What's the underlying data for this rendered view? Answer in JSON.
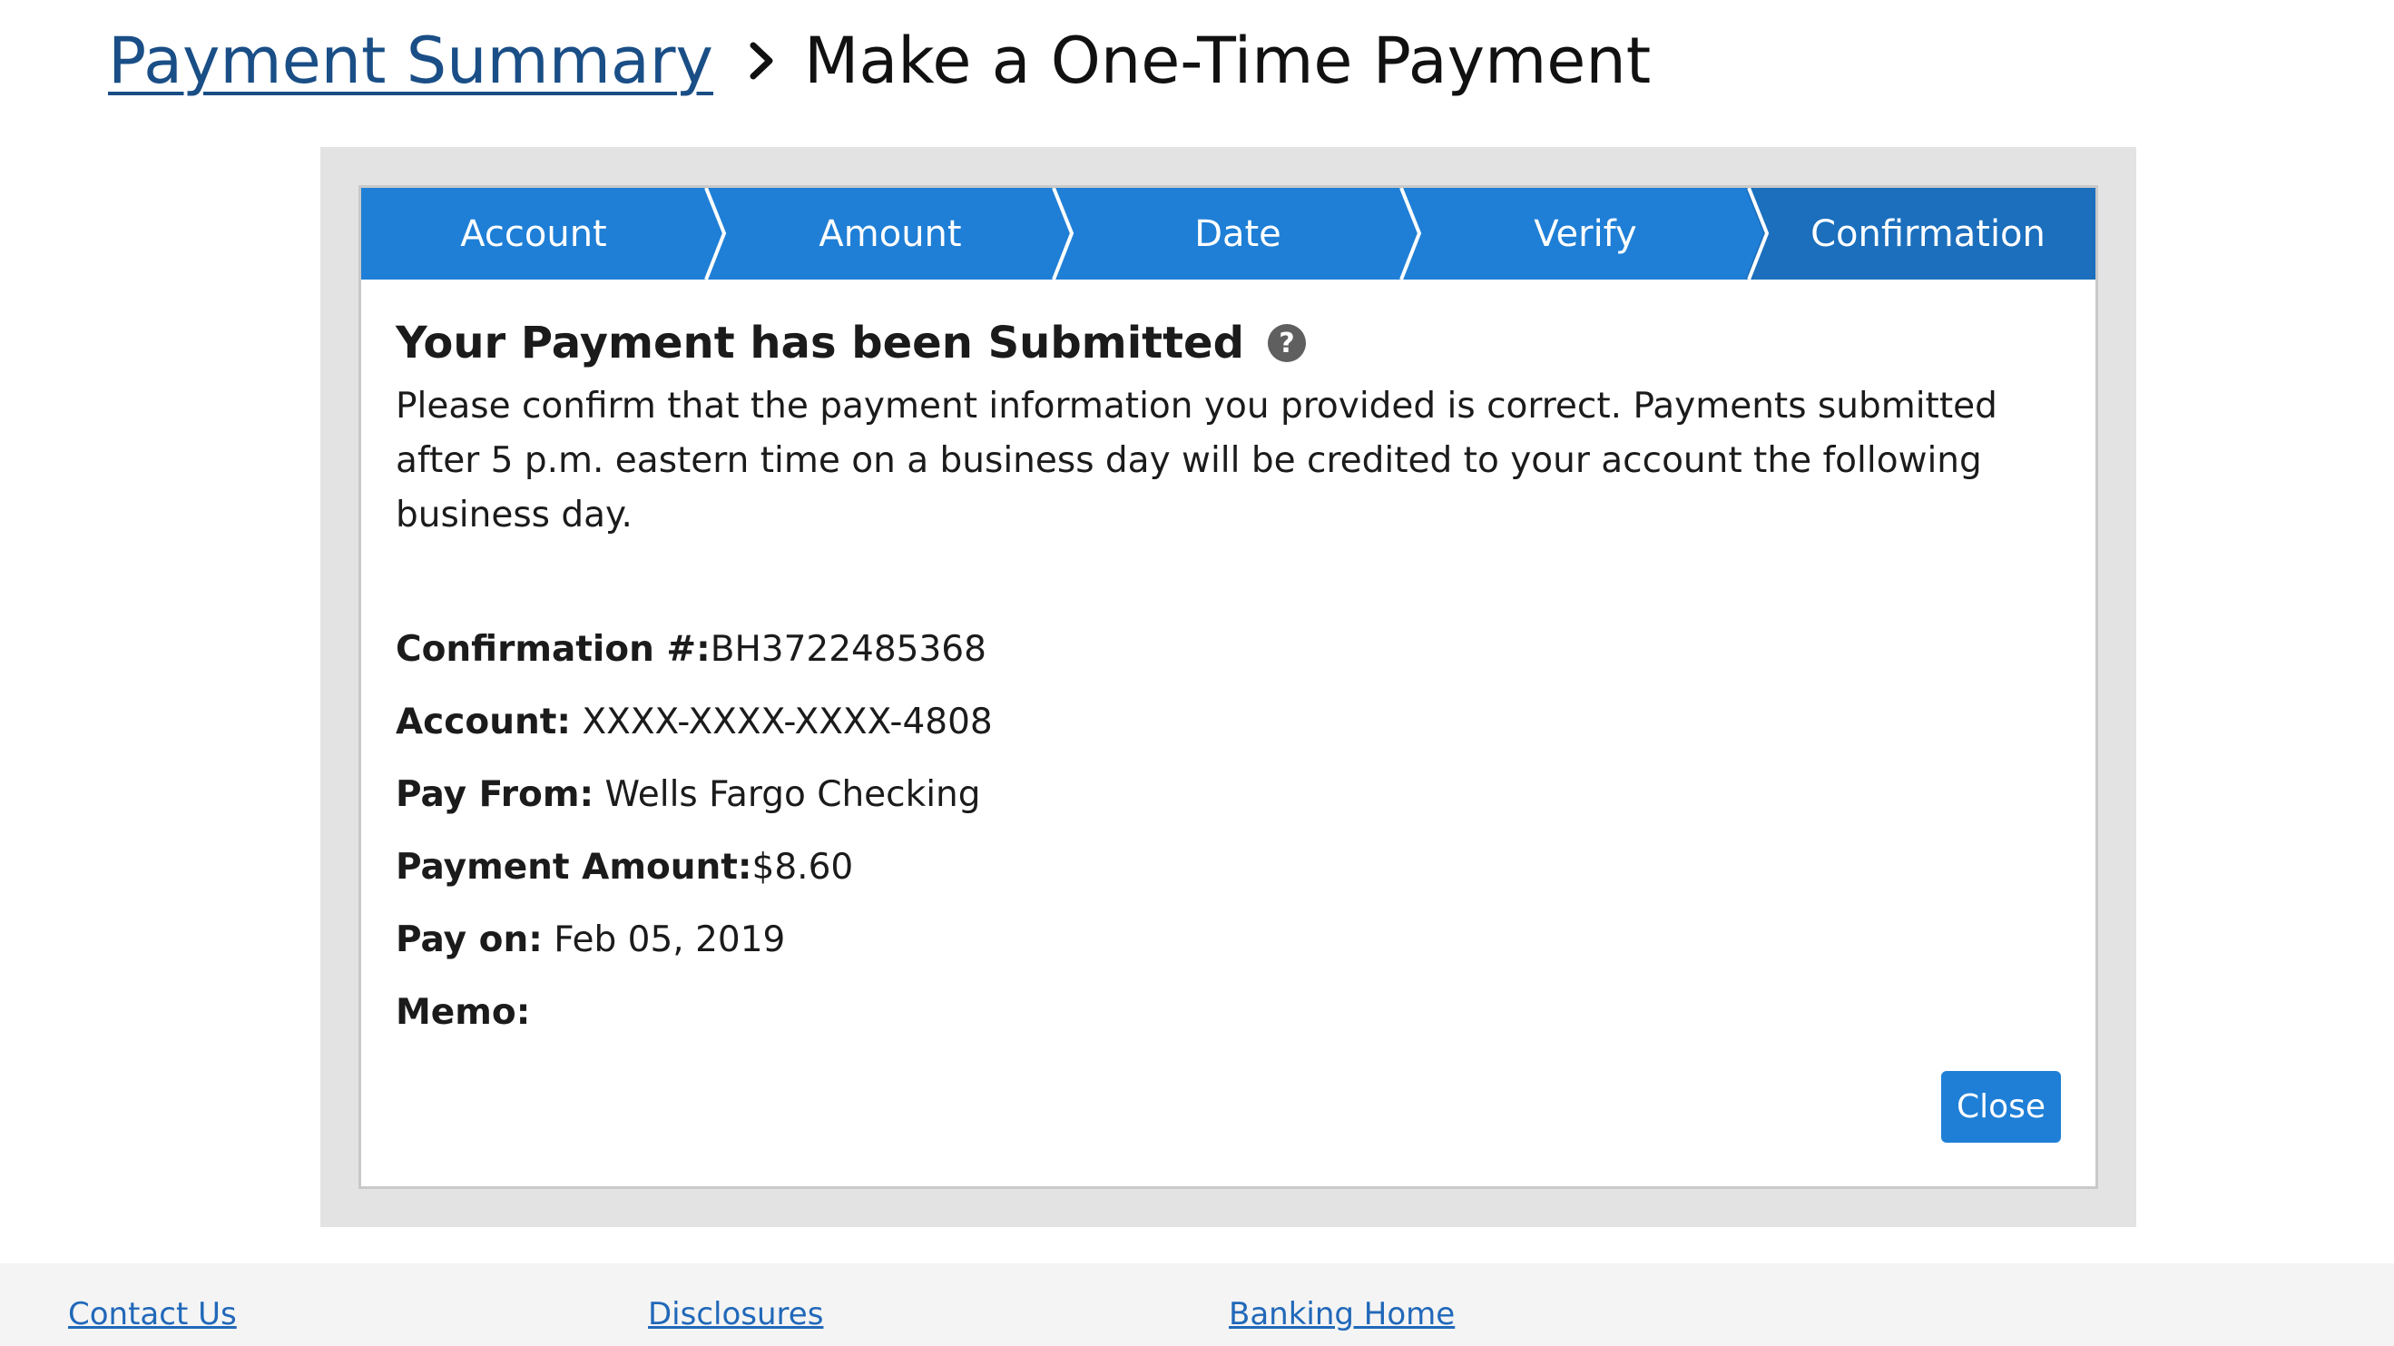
{
  "breadcrumb": {
    "parent_label": "Payment Summary",
    "current_label": "Make a One-Time Payment"
  },
  "stepper": {
    "steps": [
      "Account",
      "Amount",
      "Date",
      "Verify",
      "Confirmation"
    ],
    "active_index": 4,
    "color": "#1f7fd6",
    "active_color": "#1b6fbd"
  },
  "confirmation": {
    "title": "Your Payment has been Submitted",
    "intro": "Please confirm that the payment information you provided is correct. Payments submitted after 5 p.m. eastern time on a business day will be credited to your account the following business day.",
    "fields": [
      {
        "label": "Confirmation #:",
        "value": "BH3722485368"
      },
      {
        "label": "Account:",
        "value": " XXXX-XXXX-XXXX-4808"
      },
      {
        "label": "Pay From:",
        "value": " Wells Fargo Checking"
      },
      {
        "label": "Payment Amount:",
        "value": "$8.60"
      },
      {
        "label": "Pay on:",
        "value": " Feb 05, 2019"
      },
      {
        "label": "Memo:",
        "value": ""
      }
    ],
    "close_label": "Close"
  },
  "footer": {
    "links": [
      "Contact Us",
      "Disclosures",
      "Banking Home"
    ]
  }
}
